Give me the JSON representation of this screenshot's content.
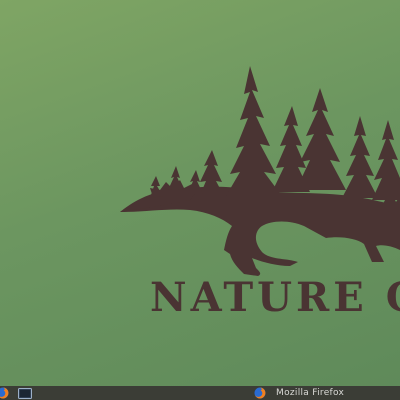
{
  "wallpaper": {
    "caption": "NATURE CA",
    "ink_color": "#4a3433",
    "background_colors": [
      "#7fa564",
      "#6c9660",
      "#5f8a5a"
    ]
  },
  "taskbar": {
    "background_color": "#3b3d36",
    "launchers": [
      {
        "icon": "firefox-icon"
      },
      {
        "icon": "terminal-icon"
      }
    ],
    "open_windows": [
      {
        "icon": "firefox-icon",
        "label": "Mozilla Firefox"
      }
    ]
  }
}
